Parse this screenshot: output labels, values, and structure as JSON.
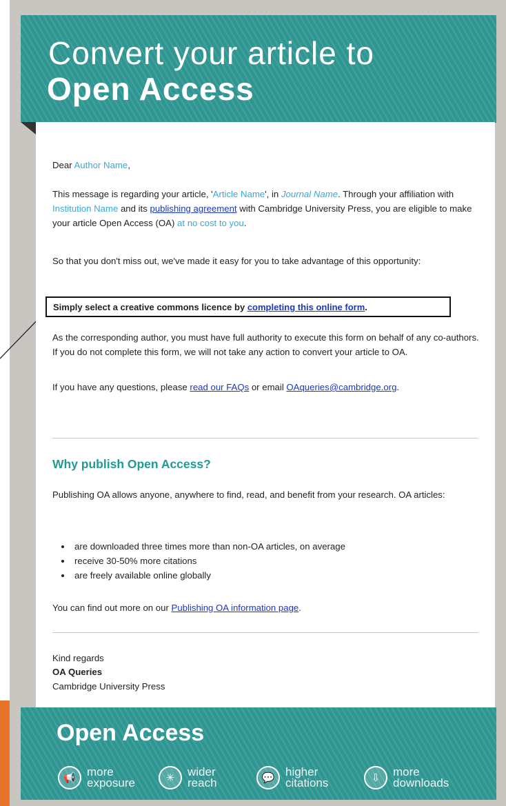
{
  "header": {
    "line1": "Convert your article to",
    "line2": "Open Access"
  },
  "greeting": {
    "prefix": "Dear ",
    "name": "Author Name",
    "suffix": ","
  },
  "para1": {
    "t1": "This message is regarding your article, '",
    "article": "Article Name",
    "t2": "', in ",
    "journal": "Journal Name",
    "t3": ". Through your affiliation with ",
    "institution": "Institution Name",
    "t4": " and its ",
    "link": "publishing agreement",
    "t5": " with Cambridge University Press, you are eligible to make your article Open Access (OA) ",
    "no_cost": "at no cost to you",
    "t6": "."
  },
  "para2": "So that you don't miss out, we've made it easy for you to take advantage of this opportunity:",
  "callout": {
    "text": "Simply select a creative commons licence by ",
    "link": "completing this online form",
    "end": "."
  },
  "para3": "As the corresponding author, you must have full authority to execute this form on behalf of any co-authors. If you do not complete this form, we will not take any action to convert your article to OA.",
  "para4": {
    "t1": "If you have any questions, please ",
    "faq_link": "read our FAQs",
    "t2": " or email ",
    "email_link": "OAqueries@cambridge.org",
    "t3": "."
  },
  "why_heading": "Why publish Open Access?",
  "why_para": "Publishing OA allows anyone, anywhere to find, read, and benefit from your research. OA articles:",
  "bullets": [
    "are downloaded three times more than non-OA articles, on average",
    "receive 30-50% more citations",
    "are freely available online globally"
  ],
  "more_info": {
    "t1": "You can find out more on our ",
    "link": "Publishing OA information page",
    "t2": "."
  },
  "signoff": {
    "regards": "Kind regards",
    "sender": "OA Queries",
    "org": "Cambridge University Press"
  },
  "footer": {
    "title": "Open Access",
    "benefits": [
      {
        "l1": "more",
        "l2": "exposure",
        "icon": "megaphone-icon"
      },
      {
        "l1": "wider",
        "l2": "reach",
        "icon": "network-icon"
      },
      {
        "l1": "higher",
        "l2": "citations",
        "icon": "speech-bubble-icon"
      },
      {
        "l1": "more",
        "l2": "downloads",
        "icon": "cloud-download-icon"
      }
    ]
  },
  "colors": {
    "teal": "#2f9692",
    "heading_teal": "#1f9a95",
    "highlight_blue": "#3aa8d8",
    "link_blue": "#1a36c9",
    "accent_orange": "#e8742a"
  }
}
